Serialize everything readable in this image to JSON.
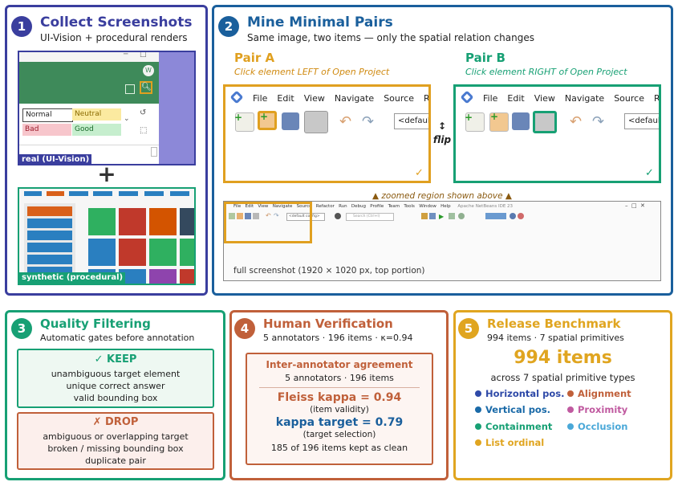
{
  "colors": {
    "blue_dark": "#3a3e9e",
    "blue_step2": "#1a5f9c",
    "orange": "#e0a020",
    "green": "#17a074",
    "brown": "#c0603a",
    "gold": "#e0a520"
  },
  "panel1": {
    "num": "1",
    "title": "Collect Screenshots",
    "subtitle": "UI-Vision + procedural renders",
    "real_caption": "real  (UI-Vision)",
    "plus": "+",
    "synthetic_caption": "synthetic  (procedural)",
    "real_app": {
      "avatar": "W",
      "styles": [
        "Normal",
        "Neutral",
        "Bad",
        "Good"
      ]
    }
  },
  "panel2": {
    "num": "2",
    "title": "Mine Minimal Pairs",
    "subtitle": "Same image, two items — only the spatial relation changes",
    "pair_a": {
      "label": "Pair A",
      "instruction": "Click element LEFT of Open Project",
      "check": "✓"
    },
    "pair_b": {
      "label": "Pair B",
      "instruction": "Click element RIGHT of Open Project",
      "check": "✓"
    },
    "flip_arrow": "↕",
    "flip": "flip",
    "menu": [
      "File",
      "Edit",
      "View",
      "Navigate",
      "Source",
      "Refact"
    ],
    "combo_text": "<defaul",
    "zoom_note": "▲  zoomed region shown above  ▲",
    "full_caption": "full screenshot  (1920 × 1020 px, top portion)",
    "full_menu": [
      "File",
      "Edit",
      "View",
      "Navigate",
      "Source",
      "Refactor",
      "Run",
      "Debug",
      "Profile",
      "Team",
      "Tools",
      "Window",
      "Help"
    ],
    "full_title": "Apache NetBeans IDE 23",
    "full_combo": "<default config>",
    "full_search": "Search (Ctrl+I)"
  },
  "panel3": {
    "num": "3",
    "title": "Quality Filtering",
    "subtitle": "Automatic gates before annotation",
    "keep_title": "✓  KEEP",
    "keep_items": [
      "unambiguous target element",
      "unique correct answer",
      "valid bounding box"
    ],
    "drop_title": "✗  DROP",
    "drop_items": [
      "ambiguous or overlapping target",
      "broken / missing bounding box",
      "duplicate pair"
    ]
  },
  "panel4": {
    "num": "4",
    "title": "Human Verification",
    "subtitle": "5 annotators · 196 items · κ=0.94",
    "box_title": "Inter-annotator agreement",
    "box_sub": "5 annotators · 196 items",
    "fleiss": "Fleiss kappa = 0.94",
    "fleiss_note": "(item validity)",
    "target": "kappa target = 0.79",
    "target_note": "(target selection)",
    "kept": "185 of 196 items kept as clean"
  },
  "panel5": {
    "num": "5",
    "title": "Release Benchmark",
    "subtitle": "994 items · 7 spatial primitives",
    "big": "994 items",
    "across": "across 7 spatial primitive types",
    "primitives": [
      {
        "name": "Horizontal pos.",
        "color": "#2f4aa8"
      },
      {
        "name": "Alignment",
        "color": "#c0603a"
      },
      {
        "name": "Vertical pos.",
        "color": "#1a6aa8"
      },
      {
        "name": "Proximity",
        "color": "#c05aa0"
      },
      {
        "name": "Containment",
        "color": "#17a074"
      },
      {
        "name": "Occlusion",
        "color": "#4aa8d8"
      },
      {
        "name": "List ordinal",
        "color": "#e0a520"
      }
    ]
  }
}
